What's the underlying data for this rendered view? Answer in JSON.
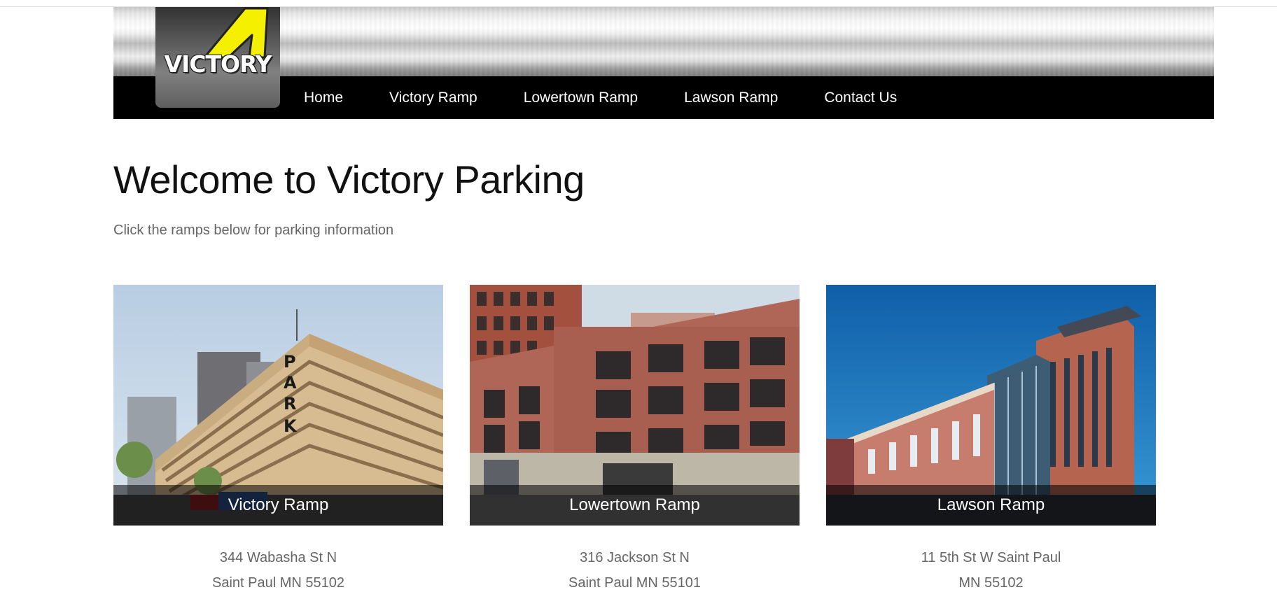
{
  "brand": {
    "logo_text": "VICTORY"
  },
  "nav": {
    "items": [
      {
        "label": "Home"
      },
      {
        "label": "Victory Ramp"
      },
      {
        "label": "Lowertown Ramp"
      },
      {
        "label": "Lawson Ramp"
      },
      {
        "label": "Contact Us"
      }
    ]
  },
  "main": {
    "title": "Welcome to Victory Parking",
    "subtitle": "Click the ramps below for parking information"
  },
  "ramps": [
    {
      "name": "Victory Ramp",
      "address_line1": "344 Wabasha St N",
      "address_line2": "Saint Paul MN 55102",
      "sign_letters": [
        "P",
        "A",
        "R",
        "K"
      ]
    },
    {
      "name": "Lowertown Ramp",
      "address_line1": "316 Jackson St N",
      "address_line2": "Saint Paul MN 55101"
    },
    {
      "name": "Lawson Ramp",
      "address_line1": "11 5th St W Saint Paul",
      "address_line2": "MN 55102"
    }
  ],
  "colors": {
    "nav_background": "#000000",
    "logo_accent": "#f5f000",
    "title_text": "#111111",
    "muted_text": "#666666"
  }
}
